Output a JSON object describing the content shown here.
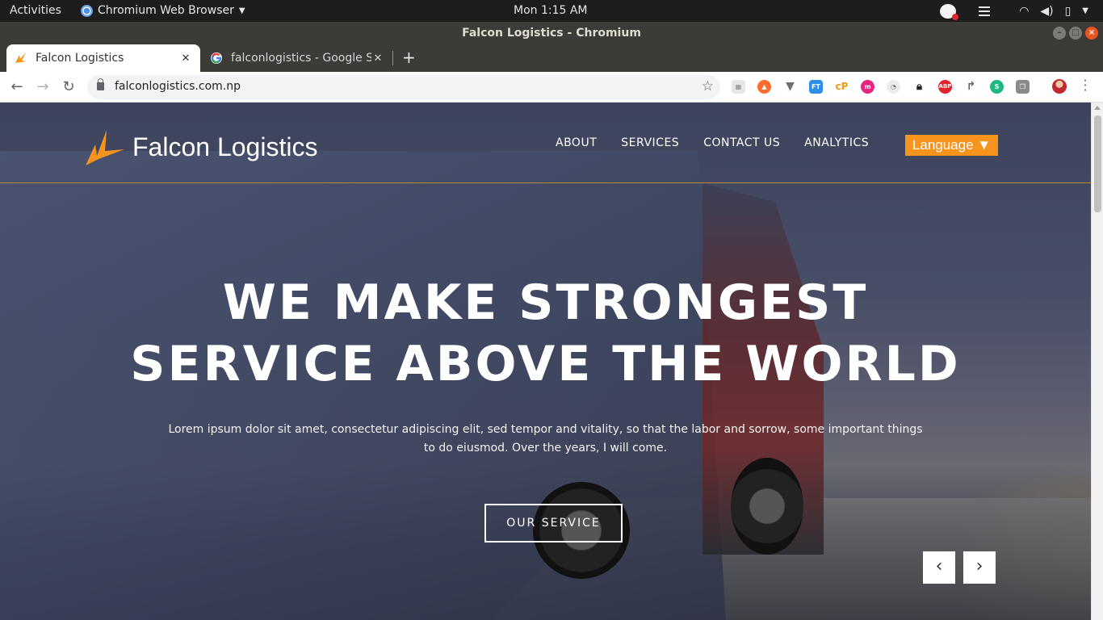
{
  "os_panel": {
    "activities": "Activities",
    "app_name": "Chromium Web Browser",
    "clock": "Mon  1:15 AM"
  },
  "window": {
    "title": "Falcon Logistics - Chromium"
  },
  "tabs": [
    {
      "title": "Falcon Logistics",
      "active": true
    },
    {
      "title": "falconlogistics - Google Se",
      "active": false
    }
  ],
  "address_bar": {
    "url": "falconlogistics.com.np"
  },
  "site": {
    "brand": "Falcon Logistics",
    "nav": [
      "ABOUT",
      "SERVICES",
      "CONTACT US",
      "ANALYTICS"
    ],
    "language_button": "Language ▼",
    "hero_line1": "WE MAKE STRONGEST",
    "hero_line2": "SERVICE ABOVE THE WORLD",
    "hero_text": "Lorem ipsum dolor sit amet, consectetur adipiscing elit, sed tempor and vitality, so that the labor and sorrow, some important things to do eiusmod. Over the years, I will come.",
    "cta": "OUR SERVICE",
    "prev_arrow": "‹",
    "next_arrow": "›"
  },
  "colors": {
    "accent": "#f7941d",
    "chrome_dark": "#3c3b37",
    "panel": "#1d1d1d"
  }
}
